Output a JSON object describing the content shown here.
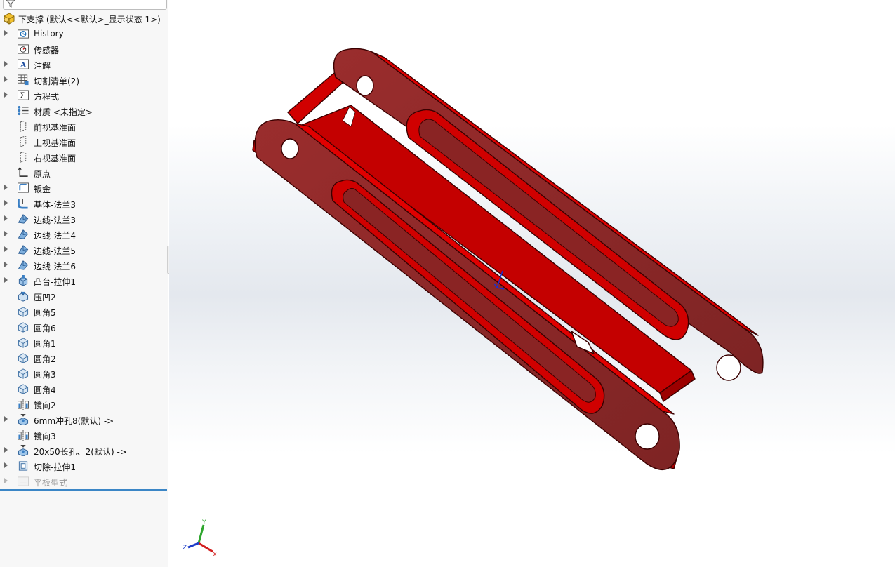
{
  "feature_tree": {
    "root": {
      "label": "下支撑 (默认<<默认>_显示状态 1>)",
      "icon": "part-icon"
    },
    "items": [
      {
        "label": "History",
        "icon": "history-folder-icon",
        "expandable": true,
        "dimmed": false
      },
      {
        "label": "传感器",
        "icon": "sensor-icon",
        "expandable": false,
        "dimmed": false
      },
      {
        "label": "注解",
        "icon": "annotation-icon",
        "expandable": true,
        "dimmed": false
      },
      {
        "label": "切割清单(2)",
        "icon": "cut-list-icon",
        "expandable": true,
        "dimmed": false
      },
      {
        "label": "方程式",
        "icon": "equation-icon",
        "expandable": true,
        "dimmed": false
      },
      {
        "label": "材质 <未指定>",
        "icon": "material-icon",
        "expandable": false,
        "dimmed": false
      },
      {
        "label": "前视基准面",
        "icon": "plane-icon",
        "expandable": false,
        "dimmed": false
      },
      {
        "label": "上视基准面",
        "icon": "plane-icon",
        "expandable": false,
        "dimmed": false
      },
      {
        "label": "右视基准面",
        "icon": "plane-icon",
        "expandable": false,
        "dimmed": false
      },
      {
        "label": "原点",
        "icon": "origin-icon",
        "expandable": false,
        "dimmed": false
      },
      {
        "label": "钣金",
        "icon": "sheet-metal-icon",
        "expandable": true,
        "dimmed": false
      },
      {
        "label": "基体-法兰3",
        "icon": "base-flange-icon",
        "expandable": true,
        "dimmed": false
      },
      {
        "label": "边线-法兰3",
        "icon": "edge-flange-icon",
        "expandable": true,
        "dimmed": false
      },
      {
        "label": "边线-法兰4",
        "icon": "edge-flange-icon",
        "expandable": true,
        "dimmed": false
      },
      {
        "label": "边线-法兰5",
        "icon": "edge-flange-icon",
        "expandable": true,
        "dimmed": false
      },
      {
        "label": "边线-法兰6",
        "icon": "edge-flange-icon",
        "expandable": true,
        "dimmed": false
      },
      {
        "label": "凸台-拉伸1",
        "icon": "boss-extrude-icon",
        "expandable": true,
        "dimmed": false
      },
      {
        "label": "压凹2",
        "icon": "indent-icon",
        "expandable": false,
        "dimmed": false
      },
      {
        "label": "圆角5",
        "icon": "fillet-icon",
        "expandable": false,
        "dimmed": false
      },
      {
        "label": "圆角6",
        "icon": "fillet-icon",
        "expandable": false,
        "dimmed": false
      },
      {
        "label": "圆角1",
        "icon": "fillet-icon",
        "expandable": false,
        "dimmed": false
      },
      {
        "label": "圆角2",
        "icon": "fillet-icon",
        "expandable": false,
        "dimmed": false
      },
      {
        "label": "圆角3",
        "icon": "fillet-icon",
        "expandable": false,
        "dimmed": false
      },
      {
        "label": "圆角4",
        "icon": "fillet-icon",
        "expandable": false,
        "dimmed": false
      },
      {
        "label": "镜向2",
        "icon": "mirror-icon",
        "expandable": false,
        "dimmed": false
      },
      {
        "label": "6mm冲孔8(默认) ->",
        "icon": "forming-tool-icon",
        "expandable": true,
        "dimmed": false
      },
      {
        "label": "镜向3",
        "icon": "mirror-icon",
        "expandable": false,
        "dimmed": false
      },
      {
        "label": "20x50长孔、2(默认) ->",
        "icon": "forming-tool-icon",
        "expandable": true,
        "dimmed": false
      },
      {
        "label": "切除-拉伸1",
        "icon": "cut-extrude-icon",
        "expandable": true,
        "dimmed": false
      },
      {
        "label": "平板型式",
        "icon": "flat-pattern-icon",
        "expandable": true,
        "dimmed": true
      }
    ]
  },
  "triad": {
    "x": "X",
    "y": "Y",
    "z": "Z"
  },
  "colors": {
    "part": "#c00000",
    "part_dark": "#8e2a2a",
    "part_edge": "#5a0000",
    "tree_bg": "#f7f7f7",
    "rollback": "#3b86c6"
  }
}
